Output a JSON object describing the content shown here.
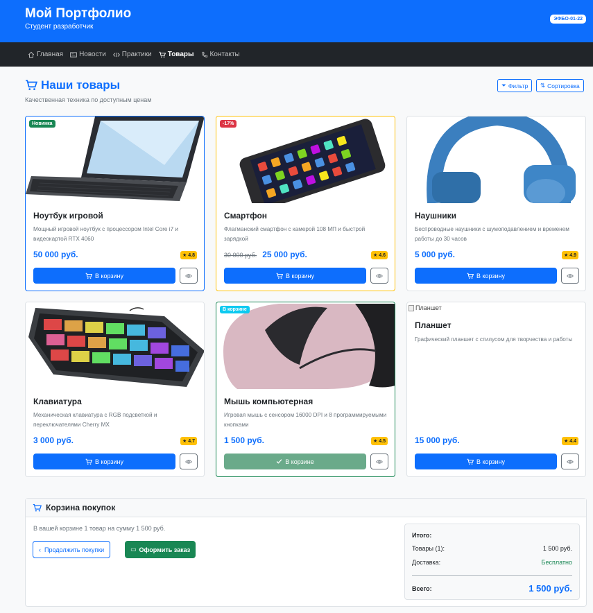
{
  "header": {
    "title": "Мой Портфолио",
    "subtitle": "Студент разработчик",
    "badge": "ЭФБО-01-22"
  },
  "nav": [
    {
      "label": "Главная",
      "icon": "house-icon"
    },
    {
      "label": "Новости",
      "icon": "newspaper-icon"
    },
    {
      "label": "Практики",
      "icon": "code-icon"
    },
    {
      "label": "Товары",
      "icon": "cart-icon",
      "active": true
    },
    {
      "label": "Контакты",
      "icon": "phone-icon"
    }
  ],
  "page": {
    "title": "Наши товары",
    "subtitle": "Качественная техника по доступным ценам",
    "filter": "Фильтр",
    "sort": "Сортировка"
  },
  "products": [
    {
      "title": "Ноутбук игровой",
      "desc": "Мощный игровой ноутбук с процессором Intel Core i7 и видеокартой RTX 4060",
      "price": "50 000 руб.",
      "old_price": "",
      "rating": "4.8",
      "tag": "Новинка",
      "tag_color": "#198754",
      "border": "#0d6efd",
      "cart_label": "В корзину",
      "in_cart": false,
      "image": "laptop"
    },
    {
      "title": "Смартфон",
      "desc": "Флагманский смартфон с камерой 108 МП и быстрой зарядкой",
      "price": "25 000 руб.",
      "old_price": "30 000 руб.",
      "rating": "4.6",
      "tag": "-17%",
      "tag_color": "#dc3545",
      "border": "#ffc107",
      "cart_label": "В корзину",
      "in_cart": false,
      "image": "smartphone"
    },
    {
      "title": "Наушники",
      "desc": "Беспроводные наушники с шумоподавлением и временем работы до 30 часов",
      "price": "5 000 руб.",
      "old_price": "",
      "rating": "4.9",
      "tag": "",
      "tag_color": "",
      "border": "",
      "cart_label": "В корзину",
      "in_cart": false,
      "image": "headphones"
    },
    {
      "title": "Клавиатура",
      "desc": "Механическая клавиатура с RGB подсветкой и переключателями Cherry MX",
      "price": "3 000 руб.",
      "old_price": "",
      "rating": "4.7",
      "tag": "",
      "tag_color": "",
      "border": "",
      "cart_label": "В корзину",
      "in_cart": false,
      "image": "keyboard"
    },
    {
      "title": "Мышь компьютерная",
      "desc": "Игровая мышь с сенсором 16000 DPI и 8 программируемыми кнопками",
      "price": "1 500 руб.",
      "old_price": "",
      "rating": "4.5",
      "tag": "В корзине",
      "tag_color": "#0dcaf0",
      "border": "#198754",
      "cart_label": "В корзине",
      "in_cart": true,
      "image": "mouse"
    },
    {
      "title": "Планшет",
      "desc": "Графический планшет с стилусом для творчества и работы",
      "price": "15 000 руб.",
      "old_price": "",
      "rating": "4.4",
      "tag": "",
      "tag_color": "",
      "border": "",
      "cart_label": "В корзину",
      "in_cart": false,
      "image": "broken",
      "alt": "Планшет"
    }
  ],
  "cart": {
    "title": "Корзина покупок",
    "info": "В вашей корзине 1 товар на сумму 1 500 руб.",
    "continue": "Продолжить покупки",
    "checkout": "Оформить заказ",
    "summary": {
      "heading": "Итого:",
      "items_label": "Товары (1):",
      "items_value": "1 500 руб.",
      "delivery_label": "Доставка:",
      "delivery_value": "Бесплатно",
      "total_label": "Всего:",
      "total_value": "1 500 руб."
    }
  },
  "colors": {
    "primary": "#0d6efd",
    "success": "#198754",
    "warning": "#ffc107",
    "dark": "#212529"
  }
}
